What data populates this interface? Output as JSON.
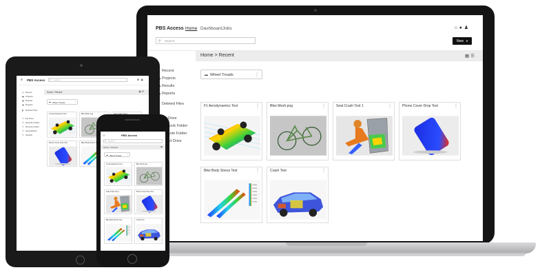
{
  "app": {
    "brand": "PBS Access",
    "nav": [
      "Home",
      "Dashboard",
      "Jobs"
    ],
    "search_placeholder": "Search",
    "new_button": "New",
    "breadcrumb": "Home > Recent",
    "sidebar": {
      "group1": [
        "Recent",
        "Projects",
        "Results",
        "Reports"
      ],
      "deleted": "Deleted Files",
      "group2": [
        "My Drive",
        "Network Folder",
        "Remote Folder",
        "Cloud Drive",
        "HyperWorks",
        "Scratch"
      ]
    },
    "folder": "Wheel Treads",
    "cards": [
      {
        "title": "F1 Aerodynamics Test"
      },
      {
        "title": "Bike Mesh.png"
      },
      {
        "title": "Seat Crash Test 1"
      },
      {
        "title": "Phone Cover Drop Test"
      },
      {
        "title": "Bike Body Stress Test"
      },
      {
        "title": "Crash Test"
      }
    ]
  },
  "icons": {
    "recent": "clock-icon",
    "folder": "folder-icon",
    "trash": "trash-icon",
    "drive": "drive-icon",
    "kebab": "kebab-icon",
    "grid": "grid-view-icon",
    "list": "list-view-icon",
    "home": "home-icon",
    "bell": "bell-icon",
    "user": "user-icon",
    "search": "search-icon",
    "menu": "hamburger-menu-icon"
  },
  "colors": {
    "topbar": "#ffffff",
    "breadcrumb_bar": "#ececec",
    "new_button_bg": "#111111",
    "device_frame": "#141414"
  }
}
